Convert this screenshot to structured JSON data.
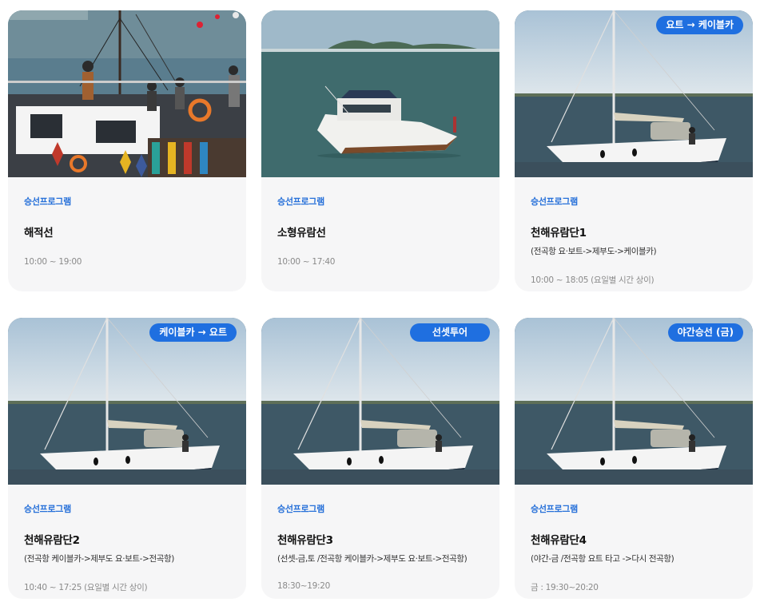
{
  "cards": [
    {
      "category": "승선프로그램",
      "title": "해적선",
      "subtitle": "",
      "time": "10:00 ~ 19:00",
      "badge": ""
    },
    {
      "category": "승선프로그램",
      "title": "소형유람선",
      "subtitle": "",
      "time": "10:00 ~ 17:40",
      "badge": ""
    },
    {
      "category": "승선프로그램",
      "title": "천해유람단1",
      "subtitle": "(전곡항 요·보트->제부도->케이블카)",
      "time": "10:00 ~ 18:05 (요일별 시간 상이)",
      "badge": "요트 → 케이블카"
    },
    {
      "category": "승선프로그램",
      "title": "천해유람단2",
      "subtitle": "(전곡항 케이블카->제부도 요·보트->전곡항)",
      "time": "10:40 ~ 17:25 (요일별 시간 상이)",
      "badge": "케이블카 → 요트"
    },
    {
      "category": "승선프로그램",
      "title": "천해유람단3",
      "subtitle": "(선셋-금,토 /전곡항 케이블카->제부도 요·보트->전곡항)",
      "time": "18:30~19:20",
      "badge": "선셋투어"
    },
    {
      "category": "승선프로그램",
      "title": "천해유람단4",
      "subtitle": "(야간-금 /전곡항 요트 타고 ->다시 전곡항)",
      "time": "금 : 19:30~20:20",
      "badge": "야간승선 (금)"
    }
  ]
}
